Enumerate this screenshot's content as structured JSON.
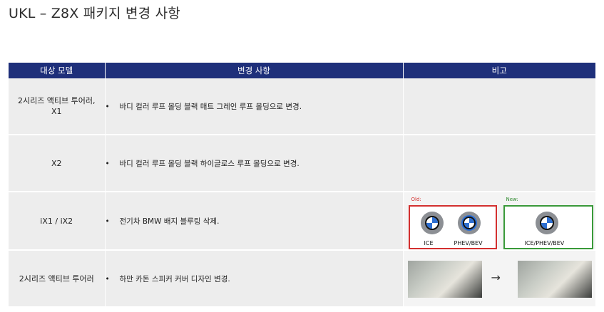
{
  "title": "UKL – Z8X 패키지 변경 사항",
  "table": {
    "headers": [
      "대상 모델",
      "변경 사항",
      "비고"
    ],
    "rows": [
      {
        "model_lines": [
          "2시리즈 액티브 투어러,",
          "X1"
        ],
        "change": "바디 컬러 루프 몰딩 블랙 매트 그레인 루프 몰딩으로 변경."
      },
      {
        "model_lines": [
          "X2"
        ],
        "change": "바디 컬러 루프 몰딩 블랙 하이글로스 루프 몰딩으로 변경."
      },
      {
        "model_lines": [
          "iX1 / iX2"
        ],
        "change": "전기차 BMW 배지 블루링 삭제."
      },
      {
        "model_lines": [
          "2시리즈 액티브 투어러"
        ],
        "change": "하만 카돈 스피커 커버 디자인 변경."
      }
    ],
    "bullet": "•"
  },
  "note_badges": {
    "old_label": "Old:",
    "new_label": "New:",
    "old_captions": [
      "ICE",
      "PHEV/BEV"
    ],
    "new_captions": [
      "ICE/PHEV/BEV"
    ],
    "arrow": "→"
  },
  "colors": {
    "header_bg": "#1e2f7a",
    "cell_bg": "#ededed",
    "old_border": "#d3302f",
    "new_border": "#3a9a3a"
  }
}
